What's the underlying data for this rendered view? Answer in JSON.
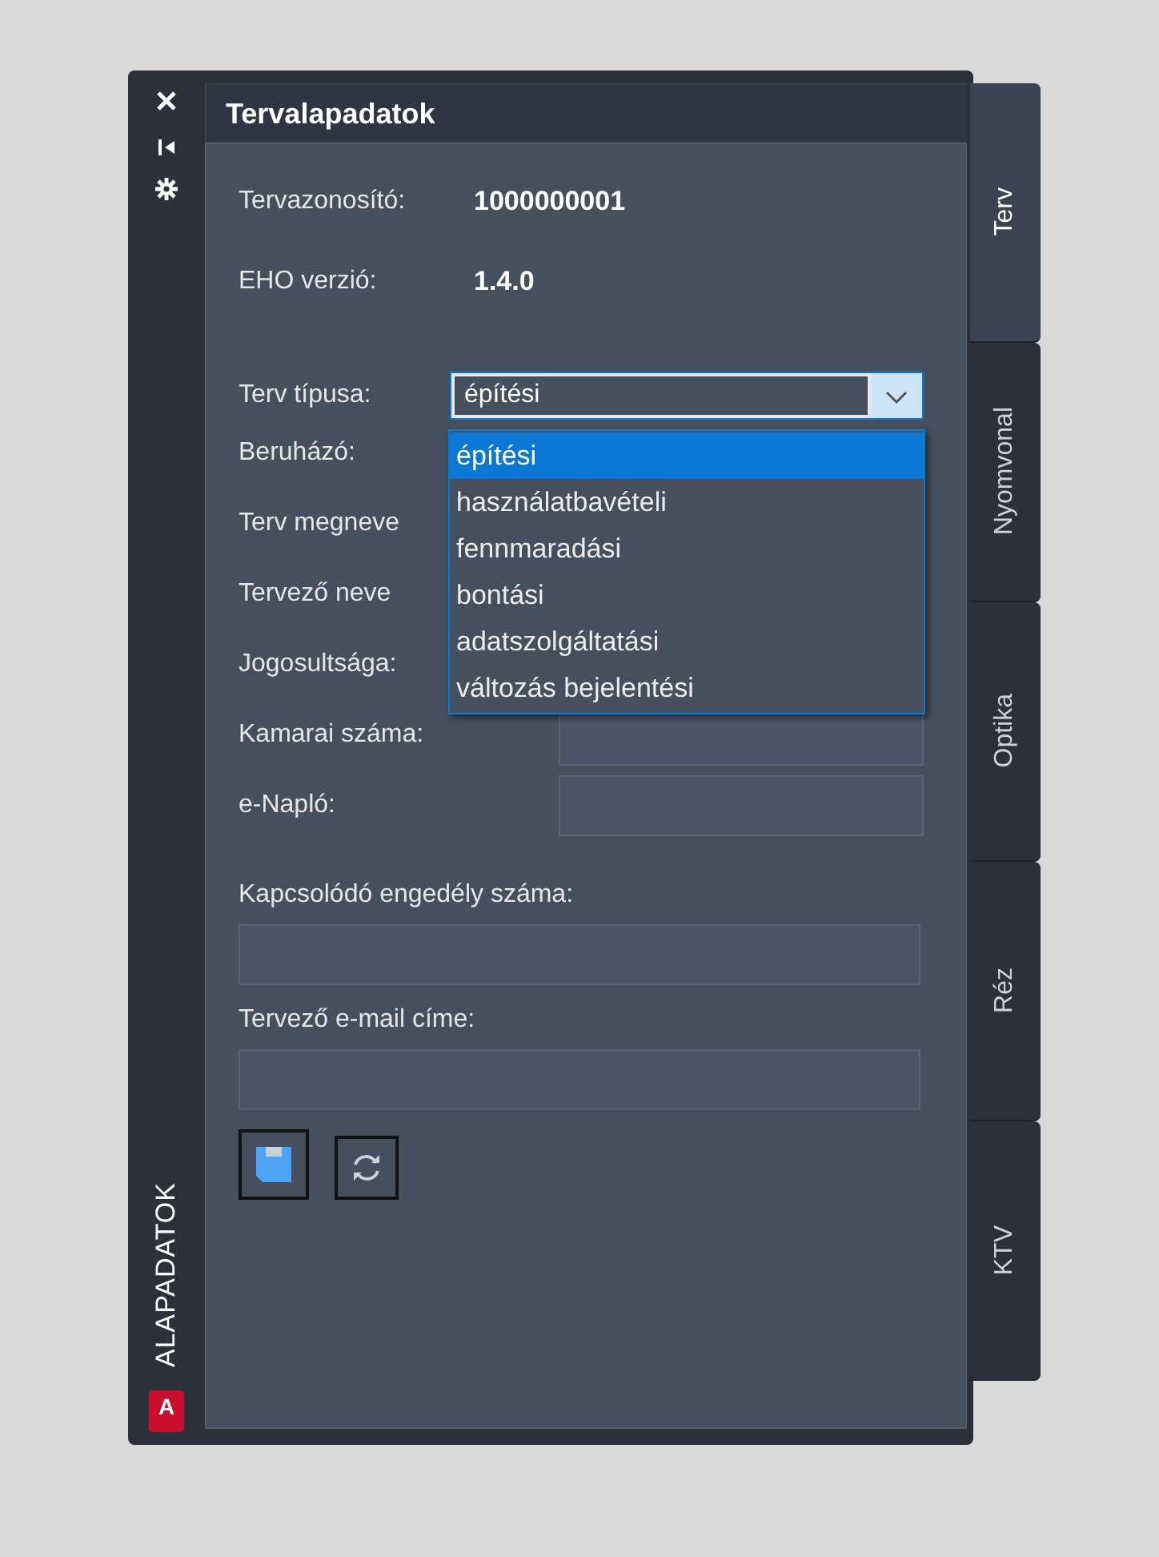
{
  "strip": {
    "title": "ALAPADATOK",
    "logo": "A"
  },
  "panel": {
    "title": "Tervalapadatok"
  },
  "info": [
    {
      "label": "Tervazonosító:",
      "value": "1000000001"
    },
    {
      "label": "EHO verzió:",
      "value": "1.4.0"
    }
  ],
  "plan_type": {
    "label": "Terv típusa:",
    "value": "építési",
    "expanded": true,
    "options": [
      {
        "label": "építési",
        "selected": true
      },
      {
        "label": "használatbavételi",
        "selected": false
      },
      {
        "label": "fennmaradási",
        "selected": false
      },
      {
        "label": "bontási",
        "selected": false
      },
      {
        "label": "adatszolgáltatási",
        "selected": false
      },
      {
        "label": "változás bejelentési",
        "selected": false
      }
    ]
  },
  "fields": [
    {
      "label": "Beruházó:",
      "kind": "covered"
    },
    {
      "label": "Terv megneve",
      "kind": "covered"
    },
    {
      "label": "Tervező neve",
      "kind": "covered"
    },
    {
      "label": "Jogosultsága:",
      "kind": "inline"
    },
    {
      "label": "Kamarai száma:",
      "kind": "inline"
    },
    {
      "label": "e-Napló:",
      "kind": "inline"
    },
    {
      "label": "Kapcsolódó engedély száma:",
      "kind": "stacked"
    },
    {
      "label": "Tervező e-mail címe:",
      "kind": "stacked"
    }
  ],
  "tabs": [
    {
      "label": "Terv",
      "selected": true
    },
    {
      "label": "Nyomvonal",
      "selected": false
    },
    {
      "label": "Optika",
      "selected": false
    },
    {
      "label": "Réz",
      "selected": false
    },
    {
      "label": "KTV",
      "selected": false
    }
  ]
}
